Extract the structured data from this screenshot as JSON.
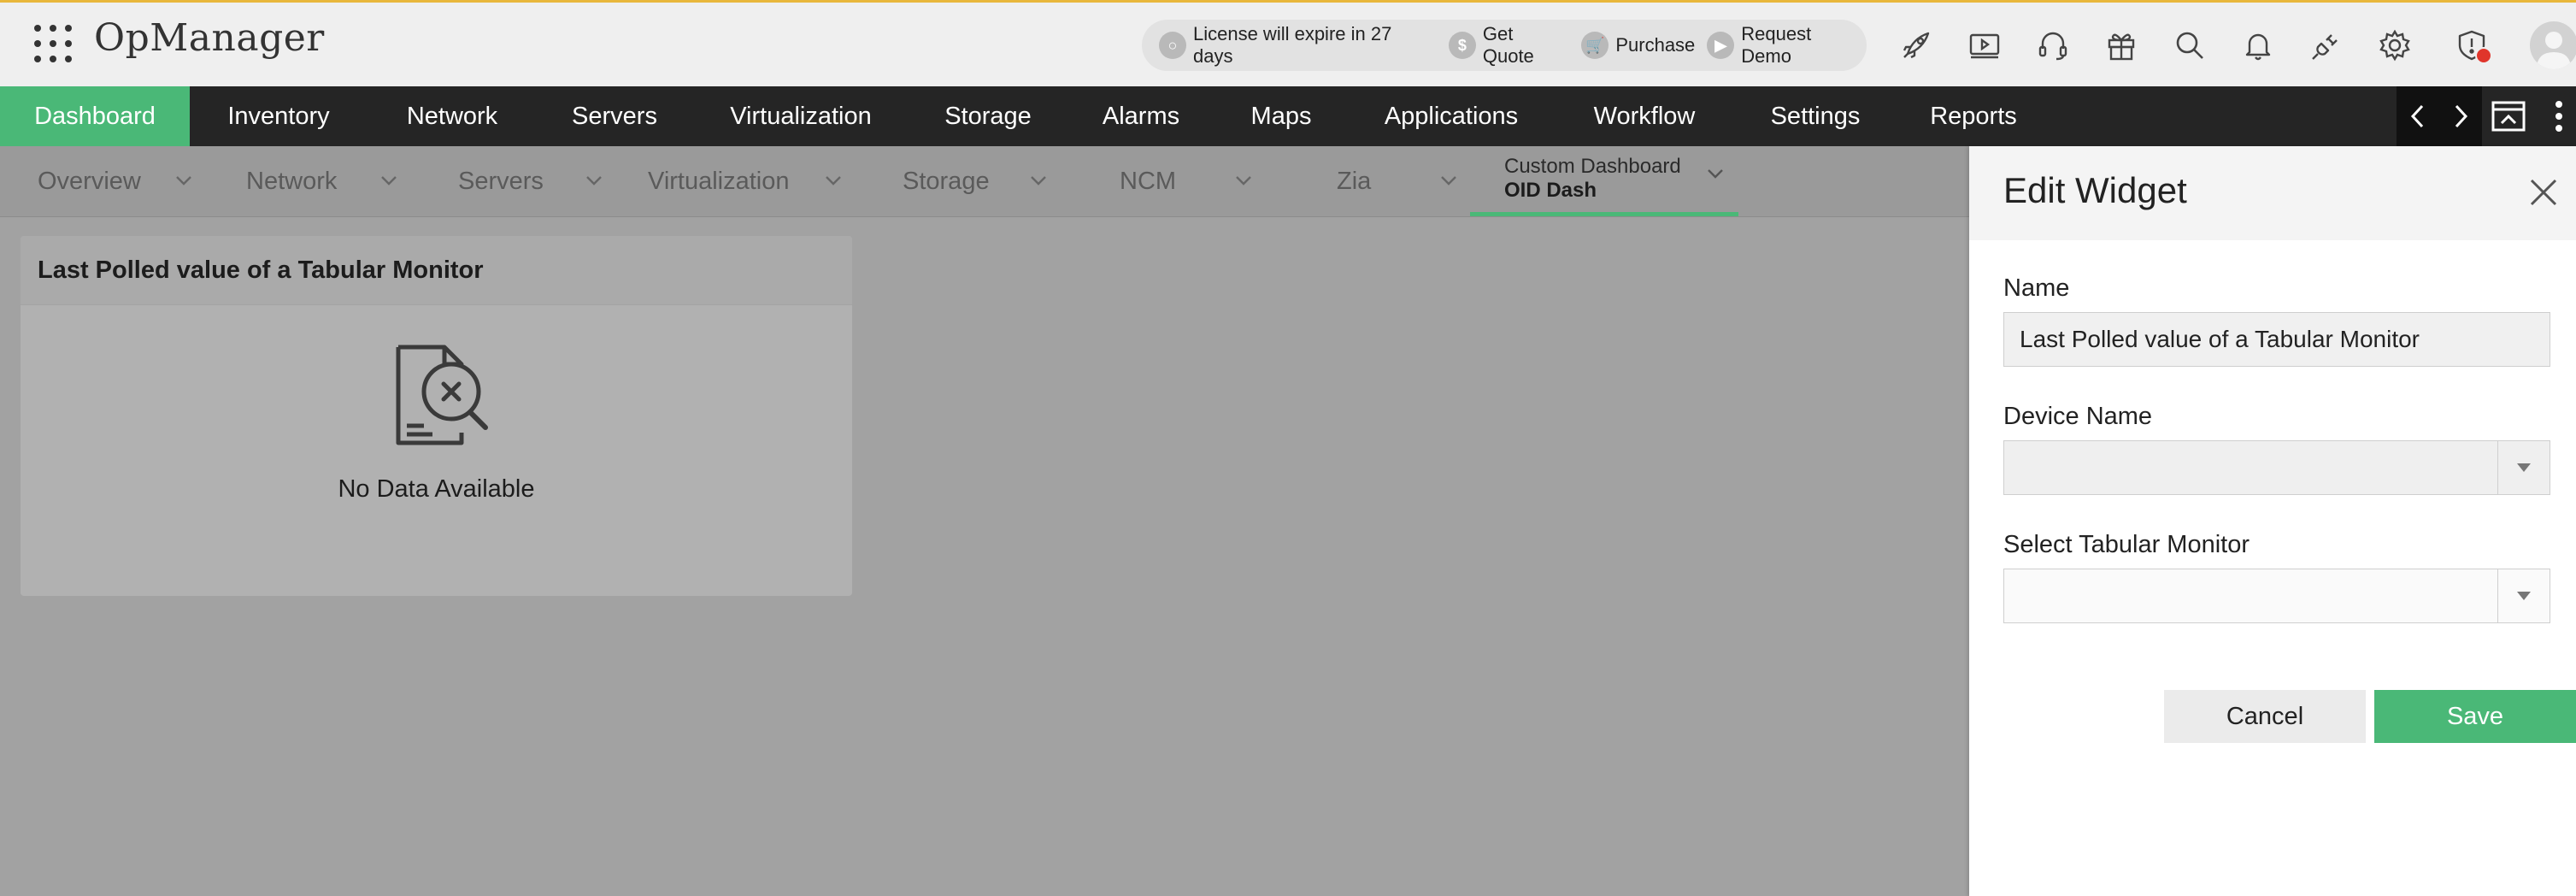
{
  "app": {
    "brand": "OpManager"
  },
  "license": {
    "expire_text": "License will expire in 27 days",
    "get_quote": "Get Quote",
    "purchase": "Purchase",
    "request_demo": "Request Demo"
  },
  "top_icons": [
    "rocket-icon",
    "video-icon",
    "headset-icon",
    "gift-icon",
    "search-icon",
    "bell-icon",
    "plug-icon",
    "gear-icon",
    "shield-alert-icon"
  ],
  "main_nav": {
    "items": [
      "Dashboard",
      "Inventory",
      "Network",
      "Servers",
      "Virtualization",
      "Storage",
      "Alarms",
      "Maps",
      "Applications",
      "Workflow",
      "Settings",
      "Reports"
    ],
    "active": "Dashboard"
  },
  "sub_nav": {
    "items": [
      "Overview",
      "Network",
      "Servers",
      "Virtualization",
      "Storage",
      "NCM",
      "Zia"
    ],
    "active_tab": {
      "line1": "Custom Dashboard",
      "line2": "OID Dash"
    }
  },
  "widget": {
    "title": "Last Polled value of a Tabular Monitor",
    "empty_message": "No Data Available"
  },
  "edit_panel": {
    "title": "Edit Widget",
    "name_label": "Name",
    "name_value": "Last Polled value of a Tabular Monitor",
    "device_label": "Device Name",
    "device_value": "",
    "monitor_label": "Select Tabular Monitor",
    "monitor_value": "",
    "cancel_label": "Cancel",
    "save_label": "Save"
  },
  "colors": {
    "accent": "#4ab877",
    "nav_bg": "#252525",
    "topbar_bg": "#efefef",
    "overlay_bg": "#a2a2a2",
    "alert": "#e0352b"
  }
}
